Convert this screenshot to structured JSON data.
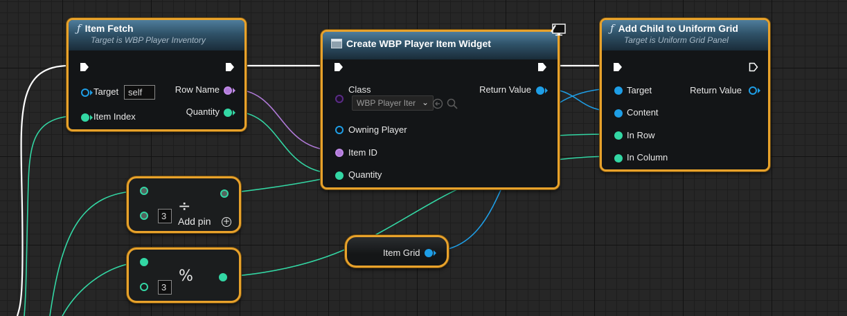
{
  "nodes": {
    "item_fetch": {
      "title": "Item Fetch",
      "subtitle": "Target is WBP Player Inventory",
      "icon": "function-icon",
      "pins": {
        "target": "Target",
        "target_value": "self",
        "item_index": "Item Index",
        "row_name": "Row Name",
        "quantity": "Quantity"
      }
    },
    "create_widget": {
      "title": "Create WBP Player Item Widget",
      "icon": "widget-icon",
      "corner_icon": "monitor-icon",
      "pins": {
        "class": "Class",
        "class_value": "WBP Player Iter",
        "owning_player": "Owning Player",
        "item_id": "Item ID",
        "quantity": "Quantity",
        "return_value": "Return Value"
      }
    },
    "add_child": {
      "title": "Add Child to Uniform Grid",
      "subtitle": "Target is Uniform Grid Panel",
      "icon": "function-icon",
      "pins": {
        "target": "Target",
        "content": "Content",
        "in_row": "In Row",
        "in_column": "In Column",
        "return_value": "Return Value"
      }
    },
    "divide": {
      "symbol": "÷",
      "input_value": "3",
      "add_pin": "Add pin"
    },
    "modulo": {
      "symbol": "%",
      "input_value": "3"
    },
    "item_grid": {
      "label": "Item Grid"
    }
  },
  "colors": {
    "node_border": "#e8a22b",
    "exec_wire": "#ffffff",
    "int_pin": "#33d7a4",
    "object_pin": "#1e9ee6",
    "name_pin": "#b07ad8",
    "header_function": "#2f5268"
  }
}
